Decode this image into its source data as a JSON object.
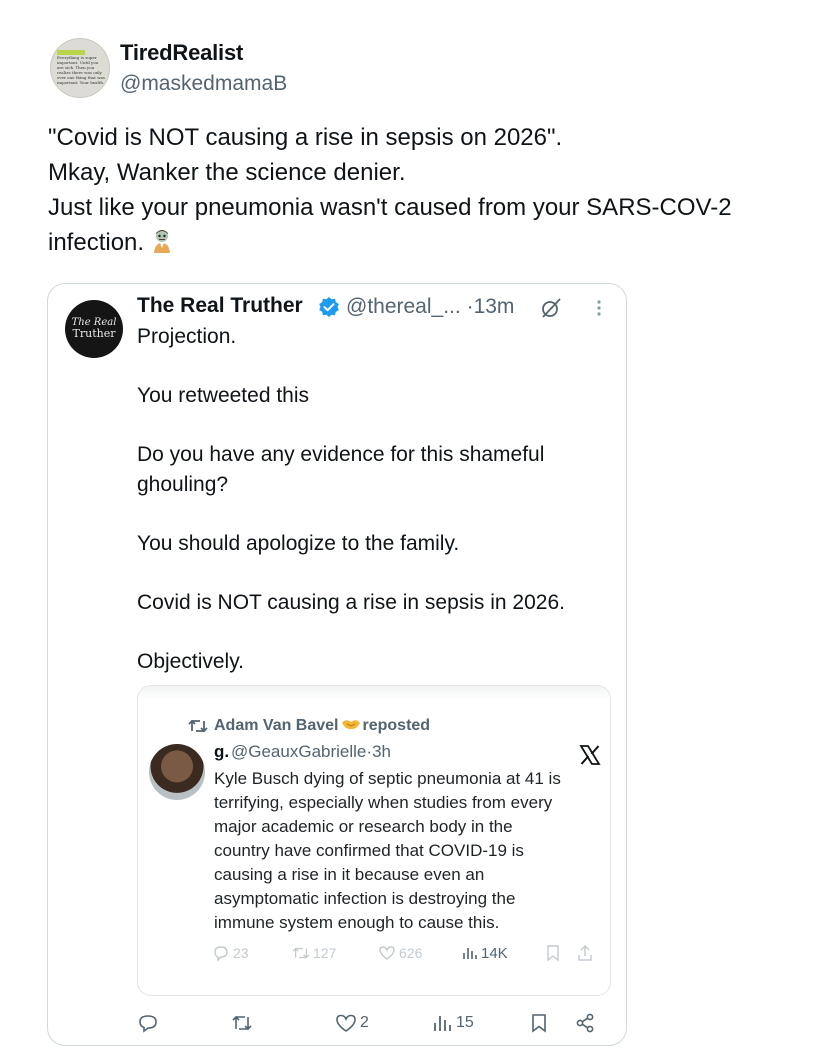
{
  "author": {
    "name": "TiredRealist",
    "handle": "@maskedmamaB",
    "avatar_text": "Everything is super important. Until you are sick. Then you realize there was only ever one thing that was important: Your health."
  },
  "tweet": {
    "lines": [
      "\"Covid is NOT causing a rise in sepsis on 2026\".",
      "Mkay, Wanker the science denier.",
      "Just like your pneumonia wasn't caused from your SARS-COV-2",
      "infection."
    ],
    "emoji_icon": "zombie-icon"
  },
  "quote": {
    "avatar_text_1": "The Real",
    "avatar_text_2": "Truther",
    "name": "The Real Truther",
    "handle": "@thereal_...",
    "separator": "·",
    "time": "13m",
    "paragraphs": [
      "Projection.",
      "You retweeted this",
      "Do you have any evidence for this shameful ghouling?",
      "You should apologize to the family.",
      "Covid is NOT causing a rise in sepsis in 2026.",
      "Objectively."
    ],
    "actions": {
      "replies": "",
      "reposts": "",
      "likes": "2",
      "views": "15"
    }
  },
  "embedded": {
    "reposter_name": "Adam Van Bavel",
    "reposted_label": "reposted",
    "name": "g.",
    "handle": "@GeauxGabrielle",
    "separator": "·",
    "time": "3h",
    "lines": [
      "Kyle Busch dying of septic pneumonia at 41 is",
      "terrifying, especially when studies from every",
      "major academic or research body in the",
      "country have confirmed that COVID-19 is",
      "causing a rise in it because even an",
      "asymptomatic infection is destroying the",
      "immune system enough to cause this."
    ],
    "stats": {
      "replies": "23",
      "reposts": "127",
      "likes": "626",
      "views": "14K"
    }
  },
  "colors": {
    "text": "#0f1419",
    "secondary": "#536471",
    "border": "#cfd9de",
    "verified": "#1d9bf0"
  }
}
